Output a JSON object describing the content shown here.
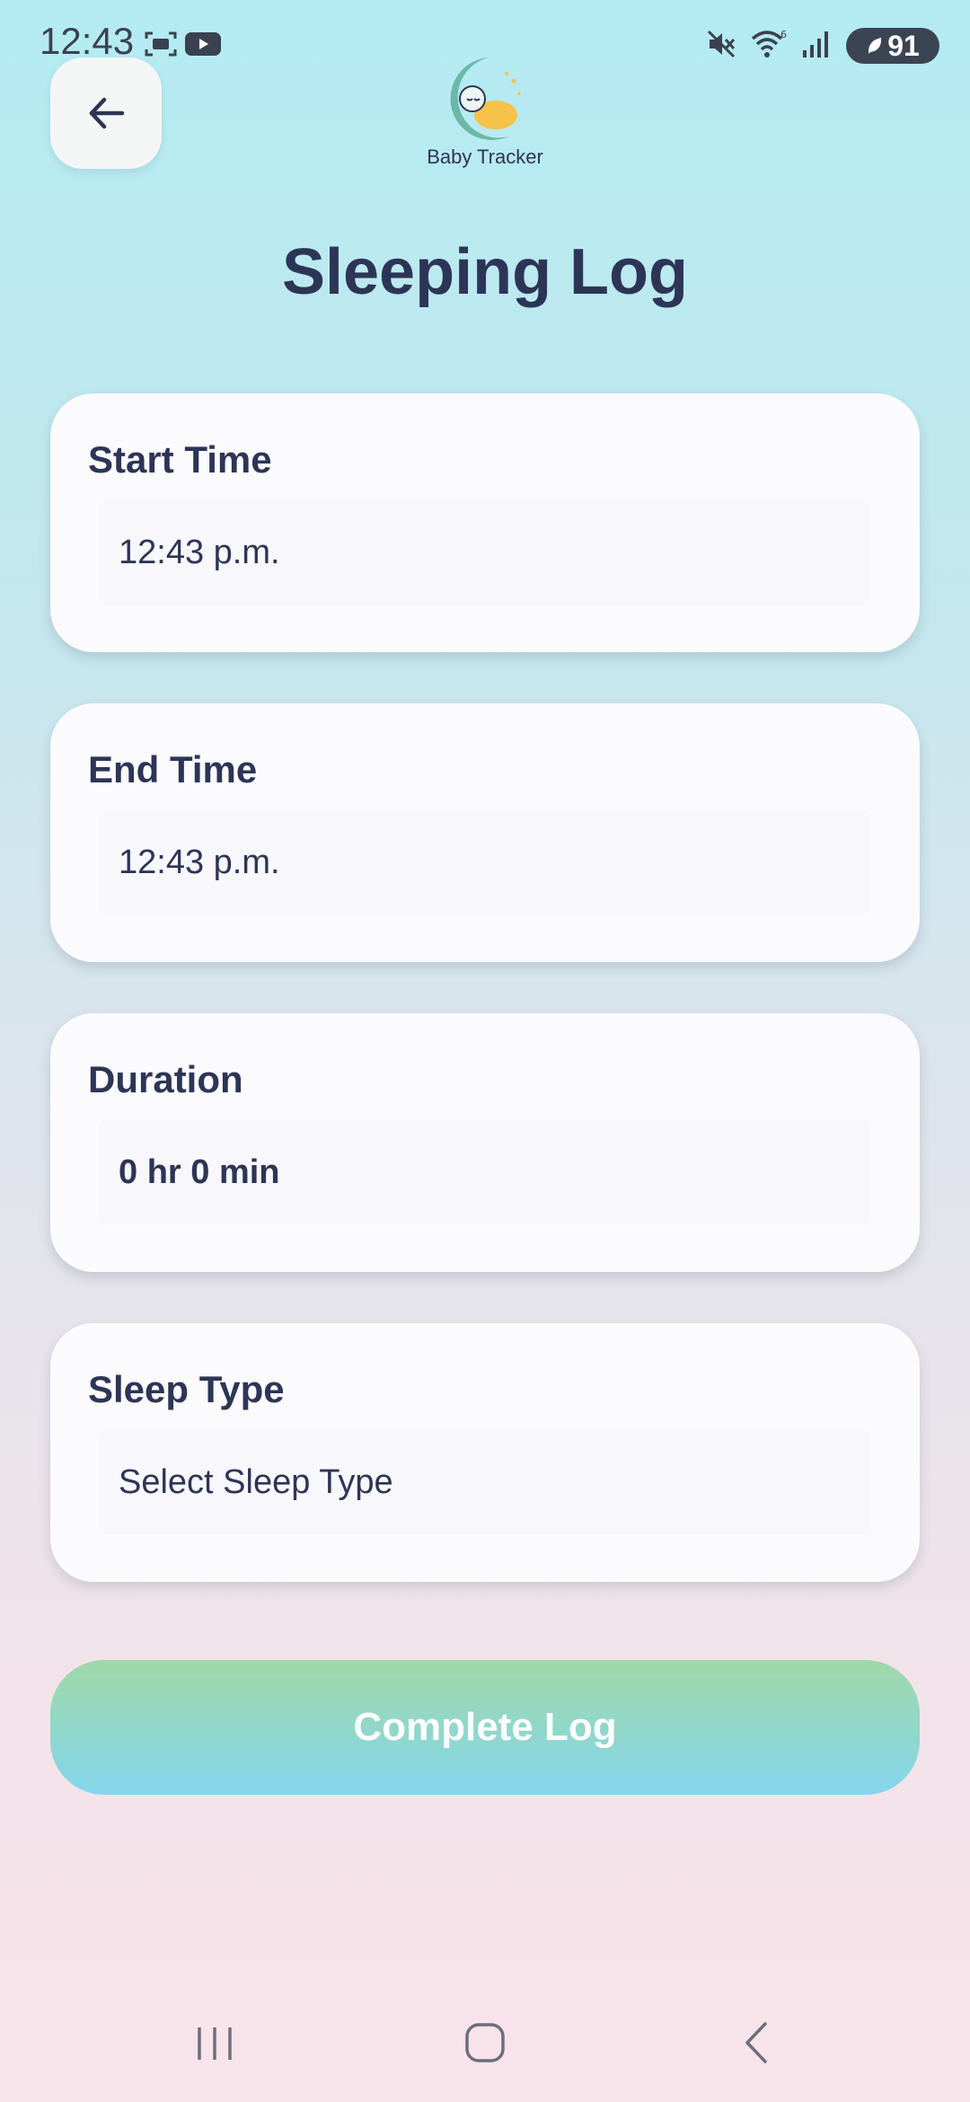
{
  "status_bar": {
    "time": "12:43",
    "battery_level": "91",
    "icons": [
      "screenshot-icon",
      "youtube-icon",
      "mute-icon",
      "wifi-icon",
      "signal-icon",
      "battery-icon"
    ]
  },
  "header": {
    "logo_text": "Baby Tracker",
    "title": "Sleeping Log"
  },
  "cards": {
    "start_time": {
      "label": "Start Time",
      "value": "12:43 p.m."
    },
    "end_time": {
      "label": "End Time",
      "value": "12:43 p.m."
    },
    "duration": {
      "label": "Duration",
      "value": "0 hr 0 min"
    },
    "sleep_type": {
      "label": "Sleep Type",
      "placeholder": "Select Sleep Type"
    }
  },
  "actions": {
    "complete_label": "Complete Log"
  },
  "colors": {
    "text": "#2d3556",
    "button_gradient_top": "#9fd8a8",
    "button_gradient_bottom": "#84d6ec",
    "card_bg": "#fbfbfd"
  }
}
